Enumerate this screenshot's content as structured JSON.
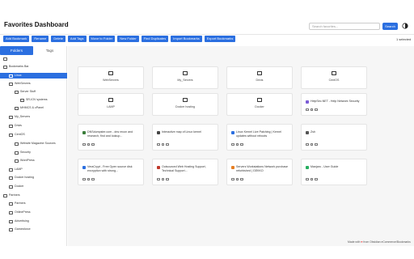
{
  "header": {
    "title": "Favorites Dashboard",
    "search_placeholder": "Search favorites...",
    "search_label": "Search"
  },
  "toolbar": {
    "buttons": [
      "Add Bookmark",
      "Rename",
      "Delete",
      "Add Tags",
      "Move to Folder",
      "New Folder",
      "Find Duplicates",
      "Import Bookmarks",
      "Export Bookmarks"
    ],
    "selection_count": "1 selected"
  },
  "sidebar": {
    "tabs": [
      "Folders",
      "Tags"
    ],
    "tree": [
      {
        "label": "",
        "level": 0
      },
      {
        "label": "Bookmarks Bar",
        "level": 0
      },
      {
        "label": "Linux",
        "level": 1,
        "selected": true
      },
      {
        "label": "WebServers",
        "level": 1
      },
      {
        "label": "Server Stuff",
        "level": 2
      },
      {
        "label": "SR-IOV systems",
        "level": 3
      },
      {
        "label": "MHMCS & cPanel",
        "level": 2
      },
      {
        "label": "My_Servers",
        "level": 1
      },
      {
        "label": "Drivis",
        "level": 1
      },
      {
        "label": "CentOS",
        "level": 1
      },
      {
        "label": "Website Magazine Sources",
        "level": 2
      },
      {
        "label": "Security",
        "level": 2
      },
      {
        "label": "WordPress",
        "level": 2
      },
      {
        "label": "LAMP",
        "level": 1
      },
      {
        "label": "Docker hosting",
        "level": 1
      },
      {
        "label": "Docker",
        "level": 1
      },
      {
        "label": "Partners",
        "level": 0
      },
      {
        "label": "Partners",
        "level": 1
      },
      {
        "label": "OnlinePress",
        "level": 1
      },
      {
        "label": "Advertising",
        "level": 1
      },
      {
        "label": "Gamesforce",
        "level": 1
      }
    ]
  },
  "folders": [
    "WebServers",
    "My_Servers",
    "Drivis",
    "CentOS",
    "LAMP",
    "Docker hosting",
    "Docker"
  ],
  "bookmarks": [
    {
      "title": "HelpSec.NET - Help Network Security",
      "color": "#7b5cd6"
    },
    {
      "title": "DNSdumpster.com - dns recon and research, find and lookup...",
      "color": "#3a7d3a"
    },
    {
      "title": "Interactive map of Linux kernel",
      "color": "#444444"
    },
    {
      "title": "Linux Kernel Live Patching | Kernel updates without reboots",
      "color": "#2b6fe0"
    },
    {
      "title": "Zsh",
      "color": "#555555"
    },
    {
      "title": "VeraCrypt - Free Open source disk encryption with strong...",
      "color": "#2b6fe0"
    },
    {
      "title": "Outsourced Web Hosting Support, Technical Support...",
      "color": "#c0392b"
    },
    {
      "title": "Servers Workstations Network purchase refurbished | GEKKO",
      "color": "#e67e22"
    },
    {
      "title": "Manjaro - User Guide",
      "color": "#27ae60"
    }
  ],
  "footer": {
    "prefix": "Made with",
    "heart": "♥",
    "suffix": "from Obsidian eCommerce/Bookmarks"
  }
}
